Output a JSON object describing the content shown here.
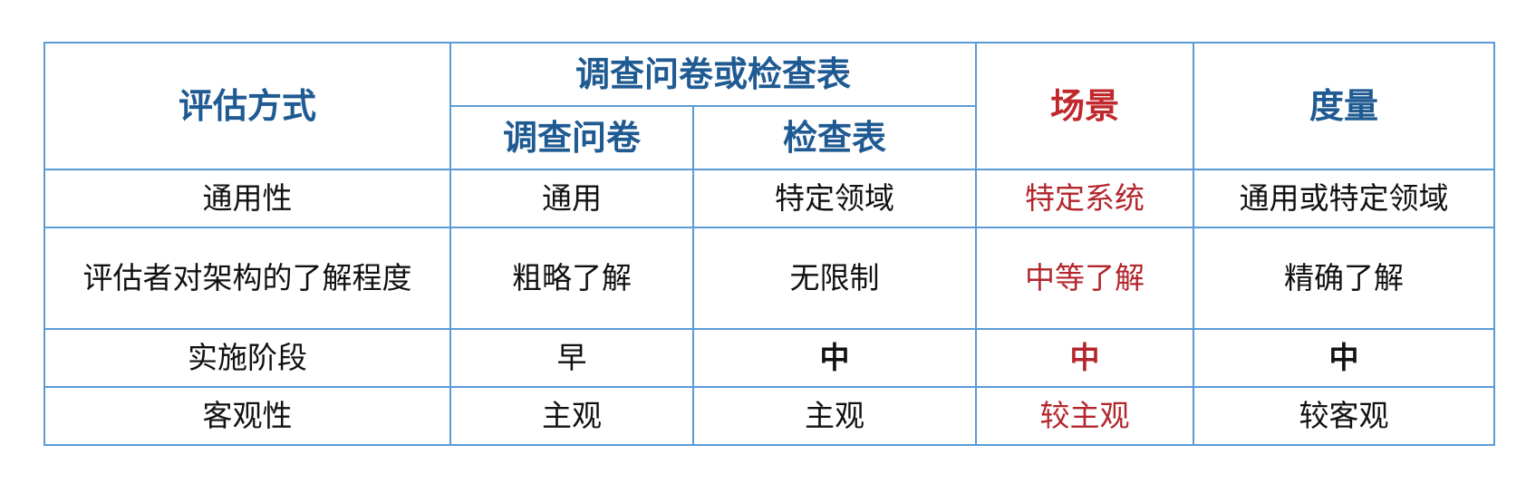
{
  "table": {
    "header": {
      "method_label": "评估方式",
      "group_label": "调查问卷或检查表",
      "sub_questionnaire": "调查问卷",
      "sub_checklist": "检查表",
      "scenario": "场景",
      "metric": "度量"
    },
    "rows": [
      {
        "label": "通用性",
        "questionnaire": "通用",
        "checklist": "特定领域",
        "scenario": "特定系统",
        "metric": "通用或特定领域"
      },
      {
        "label": "评估者对架构的了解程度",
        "questionnaire": "粗略了解",
        "checklist": "无限制",
        "scenario": "中等了解",
        "metric": "精确了解"
      },
      {
        "label": "实施阶段",
        "questionnaire": "早",
        "checklist": "中",
        "scenario": "中",
        "metric": "中"
      },
      {
        "label": "客观性",
        "questionnaire": "主观",
        "checklist": "主观",
        "scenario": "较主观",
        "metric": "较客观"
      }
    ],
    "colors": {
      "border": "#5b9bd5",
      "header_blue": "#1f5a92",
      "scenario_red": "#c0282d"
    }
  }
}
